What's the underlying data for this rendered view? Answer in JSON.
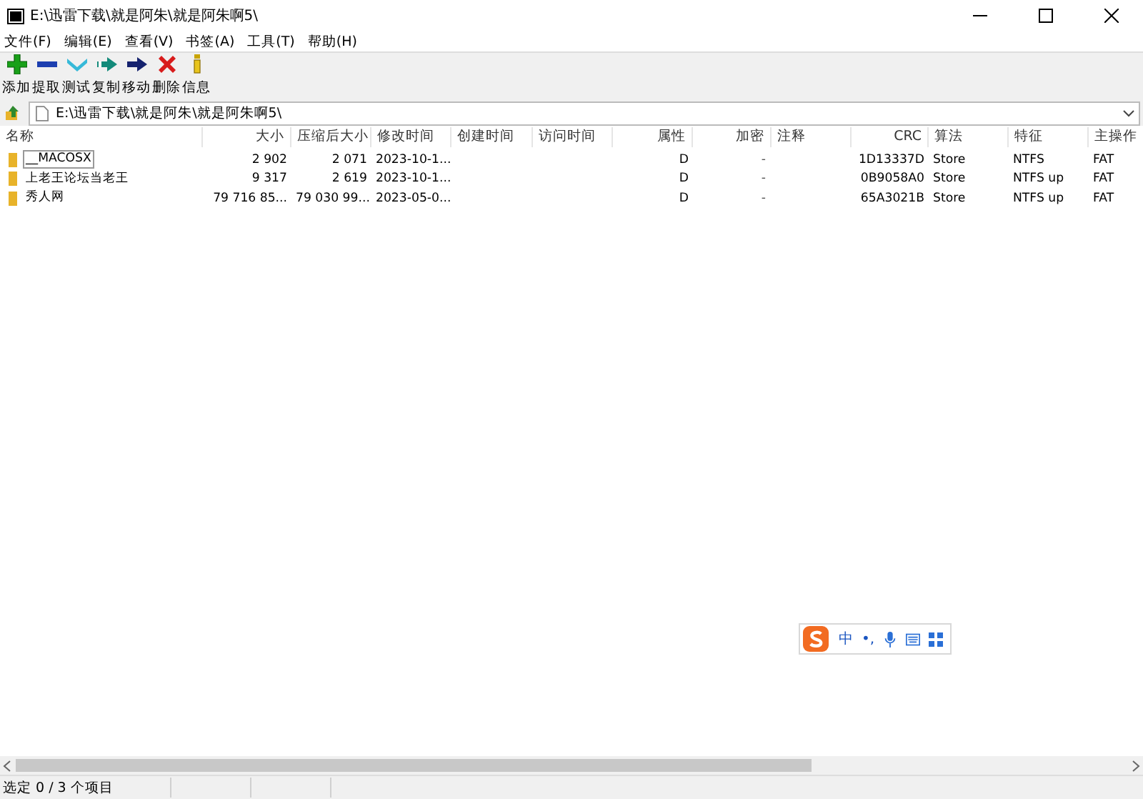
{
  "window": {
    "title": "E:\\迅雷下载\\就是阿朱\\就是阿朱啊5\\"
  },
  "menu": [
    "文件(F)",
    "编辑(E)",
    "查看(V)",
    "书签(A)",
    "工具(T)",
    "帮助(H)"
  ],
  "toolbar": [
    {
      "kind": "add",
      "label": "添加"
    },
    {
      "kind": "extract",
      "label": "提取"
    },
    {
      "kind": "test",
      "label": "测试"
    },
    {
      "kind": "copy",
      "label": "复制"
    },
    {
      "kind": "move",
      "label": "移动"
    },
    {
      "kind": "delete",
      "label": "删除"
    },
    {
      "kind": "info",
      "label": "信息"
    }
  ],
  "address": {
    "value": "E:\\迅雷下载\\就是阿朱\\就是阿朱啊5\\"
  },
  "table": {
    "columns": [
      "名称",
      "大小",
      "压缩后大小",
      "修改时间",
      "创建时间",
      "访问时间",
      "属性",
      "加密",
      "注释",
      "CRC",
      "算法",
      "特征",
      "主操作"
    ],
    "rows": [
      {
        "focused": true,
        "cells": [
          "__MACOSX",
          "2 902",
          "2 071",
          "2023-10-1...",
          "",
          "",
          "D",
          "-",
          "",
          "1D13337D",
          "Store",
          "NTFS",
          "FAT"
        ]
      },
      {
        "focused": false,
        "cells": [
          "上老王论坛当老王",
          "9 317",
          "2 619",
          "2023-10-1...",
          "",
          "",
          "D",
          "-",
          "",
          "0B9058A0",
          "Store",
          "NTFS up",
          "FAT"
        ]
      },
      {
        "focused": false,
        "cells": [
          "秀人网",
          "79 716 85...",
          "79 030 99...",
          "2023-05-0...",
          "",
          "",
          "D",
          "-",
          "",
          "65A3021B",
          "Store",
          "NTFS up",
          "FAT"
        ]
      }
    ]
  },
  "ime_bar": {
    "mode": "中",
    "punctuation": "•,"
  },
  "status_bar": [
    "选定 0 / 3 个项目"
  ]
}
